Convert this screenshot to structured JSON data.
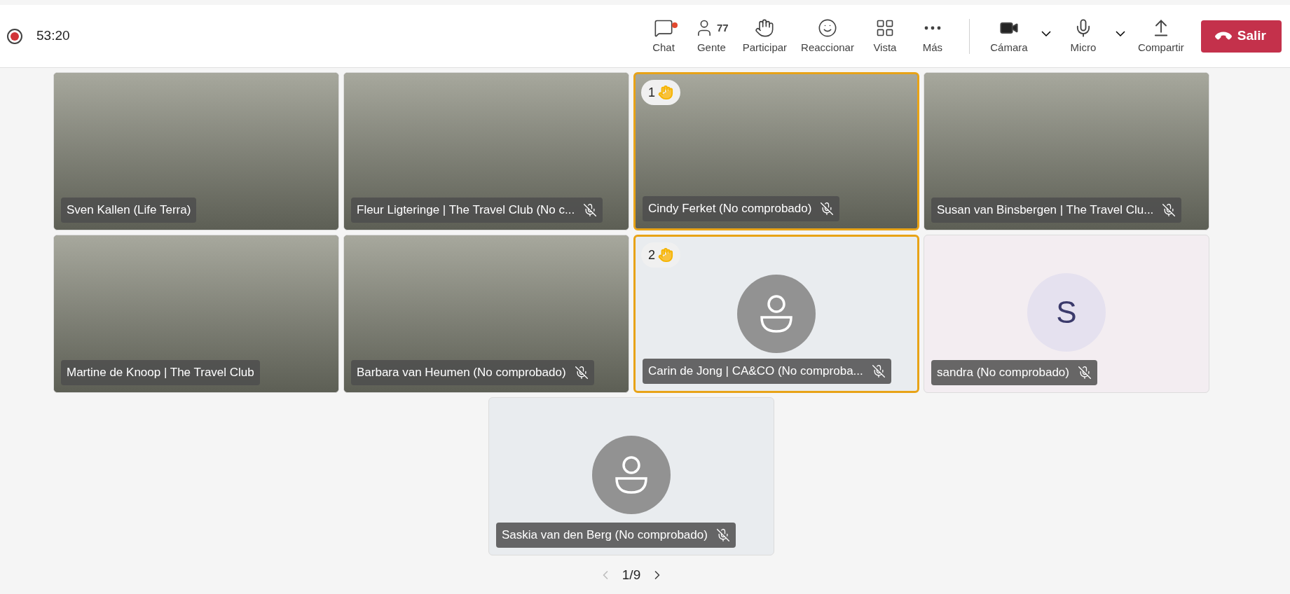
{
  "recording": {
    "time": "53:20"
  },
  "toolbar": [
    {
      "kind": "chat",
      "label": "Chat",
      "badge": true
    },
    {
      "kind": "people",
      "label": "Gente",
      "count": "77"
    },
    {
      "kind": "hand",
      "label": "Participar"
    },
    {
      "kind": "react",
      "label": "Reaccionar"
    },
    {
      "kind": "view",
      "label": "Vista"
    },
    {
      "kind": "more",
      "label": "Más"
    }
  ],
  "devices": [
    {
      "kind": "camera",
      "label": "Cámara"
    },
    {
      "kind": "mic",
      "label": "Micro"
    },
    {
      "kind": "share",
      "label": "Compartir"
    }
  ],
  "leave_button": {
    "label": "Salir"
  },
  "tiles": [
    {
      "kind": "video",
      "name": "Sven Kallen (Life Terra)",
      "muted": false,
      "hand": false
    },
    {
      "kind": "video",
      "name": "Fleur Ligteringe | The Travel Club (No c...",
      "muted": true,
      "hand": false
    },
    {
      "kind": "video",
      "name": "Cindy Ferket (No comprobado)",
      "muted": true,
      "hand": true,
      "hand_number": "1"
    },
    {
      "kind": "video",
      "name": "Susan van Binsbergen | The Travel Clu...",
      "muted": true,
      "hand": false
    },
    {
      "kind": "video",
      "name": "Martine de Knoop | The Travel Club",
      "muted": false,
      "hand": false
    },
    {
      "kind": "video",
      "name": "Barbara van Heumen (No comprobado)",
      "muted": true,
      "hand": false
    },
    {
      "kind": "avatar",
      "name": "Carin de Jong | CA&CO (No comproba...",
      "muted": true,
      "hand": true,
      "hand_number": "2"
    },
    {
      "kind": "initial",
      "initial": "S",
      "name": "sandra (No comprobado)",
      "muted": true,
      "hand": false
    },
    {
      "kind": "avatar",
      "name": "Saskia van den Berg (No comprobado)",
      "muted": true,
      "hand": false
    }
  ],
  "pagination": {
    "page": "1/9"
  }
}
